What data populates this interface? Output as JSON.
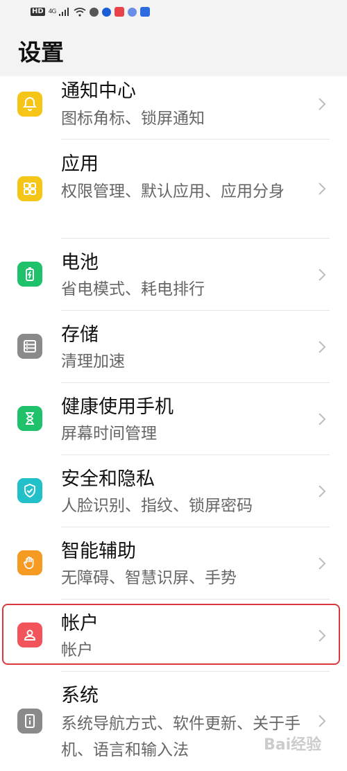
{
  "status_bar": {
    "hd": "HD",
    "network": "4G"
  },
  "header": {
    "title": "设置"
  },
  "items": [
    {
      "title": "通知中心",
      "subtitle": "图标角标、锁屏通知",
      "icon": "bell-icon",
      "color": "#f5c518"
    },
    {
      "title": "应用",
      "subtitle": "权限管理、默认应用、应用分身",
      "icon": "apps-grid-icon",
      "color": "#f5c518"
    },
    {
      "title": "电池",
      "subtitle": "省电模式、耗电排行",
      "icon": "battery-icon",
      "color": "#1fc16b"
    },
    {
      "title": "存储",
      "subtitle": "清理加速",
      "icon": "storage-icon",
      "color": "#8a8a8a"
    },
    {
      "title": "健康使用手机",
      "subtitle": "屏幕时间管理",
      "icon": "hourglass-icon",
      "color": "#1fc16b"
    },
    {
      "title": "安全和隐私",
      "subtitle": "人脸识别、指纹、锁屏密码",
      "icon": "shield-check-icon",
      "color": "#22c0c8"
    },
    {
      "title": "智能辅助",
      "subtitle": "无障碍、智慧识屏、手势",
      "icon": "hand-icon",
      "color": "#f59a23"
    },
    {
      "title": "帐户",
      "subtitle": "帐户",
      "icon": "account-icon",
      "color": "#f2545b"
    },
    {
      "title": "系统",
      "subtitle": "系统导航方式、软件更新、关于手机、语言和输入法",
      "icon": "system-info-icon",
      "color": "#8a8a8a"
    }
  ],
  "watermark": "Bai经验"
}
